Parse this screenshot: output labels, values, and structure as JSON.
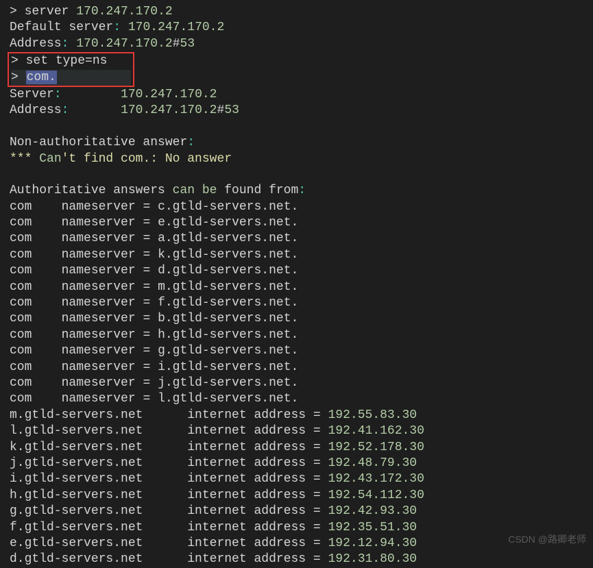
{
  "header": {
    "prompt1_gt": ">",
    "prompt1_cmd": "server",
    "prompt1_arg": "170.247.170.2",
    "default_server_label": "Default server",
    "default_server_ip": "170.247.170.2",
    "address_label": "Address",
    "address_ip": "170.247.170.2",
    "hash": "#",
    "port": "53"
  },
  "boxed": {
    "prompt2_gt": ">",
    "prompt2_cmd": "set type=ns",
    "prompt3_gt": ">",
    "prompt3_sel": "com.",
    "prompt3_after": "                          "
  },
  "server_block": {
    "server_label": "Server",
    "server_ip": "170.247.170.2",
    "address_label": "Address",
    "address_ip": "170.247.170.2",
    "hash": "#",
    "port": "53"
  },
  "non_auth": {
    "label": "Non-authoritative answer",
    "colon": ":",
    "stars": "***",
    "cant": "Can",
    "rest": "'t find com.: No answer"
  },
  "auth_header": {
    "pre": "Authoritative answers ",
    "can_be": "can be",
    "post": " found from",
    "colon": ":"
  },
  "nameservers": [
    {
      "dom": "com",
      "ns": "c.gtld-servers.net."
    },
    {
      "dom": "com",
      "ns": "e.gtld-servers.net."
    },
    {
      "dom": "com",
      "ns": "a.gtld-servers.net."
    },
    {
      "dom": "com",
      "ns": "k.gtld-servers.net."
    },
    {
      "dom": "com",
      "ns": "d.gtld-servers.net."
    },
    {
      "dom": "com",
      "ns": "m.gtld-servers.net."
    },
    {
      "dom": "com",
      "ns": "f.gtld-servers.net."
    },
    {
      "dom": "com",
      "ns": "b.gtld-servers.net."
    },
    {
      "dom": "com",
      "ns": "h.gtld-servers.net."
    },
    {
      "dom": "com",
      "ns": "g.gtld-servers.net."
    },
    {
      "dom": "com",
      "ns": "i.gtld-servers.net."
    },
    {
      "dom": "com",
      "ns": "j.gtld-servers.net."
    },
    {
      "dom": "com",
      "ns": "l.gtld-servers.net."
    }
  ],
  "ns_label": "nameserver",
  "eq": " = ",
  "inet_label": "internet address",
  "addresses": [
    {
      "host": "m.gtld-servers.net",
      "ip": "192.55.83.30"
    },
    {
      "host": "l.gtld-servers.net",
      "ip": "192.41.162.30"
    },
    {
      "host": "k.gtld-servers.net",
      "ip": "192.52.178.30"
    },
    {
      "host": "j.gtld-servers.net",
      "ip": "192.48.79.30"
    },
    {
      "host": "i.gtld-servers.net",
      "ip": "192.43.172.30"
    },
    {
      "host": "h.gtld-servers.net",
      "ip": "192.54.112.30"
    },
    {
      "host": "g.gtld-servers.net",
      "ip": "192.42.93.30"
    },
    {
      "host": "f.gtld-servers.net",
      "ip": "192.35.51.30"
    },
    {
      "host": "e.gtld-servers.net",
      "ip": "192.12.94.30"
    },
    {
      "host": "d.gtld-servers.net",
      "ip": "192.31.80.30"
    }
  ],
  "watermark": "CSDN @路卿老师"
}
